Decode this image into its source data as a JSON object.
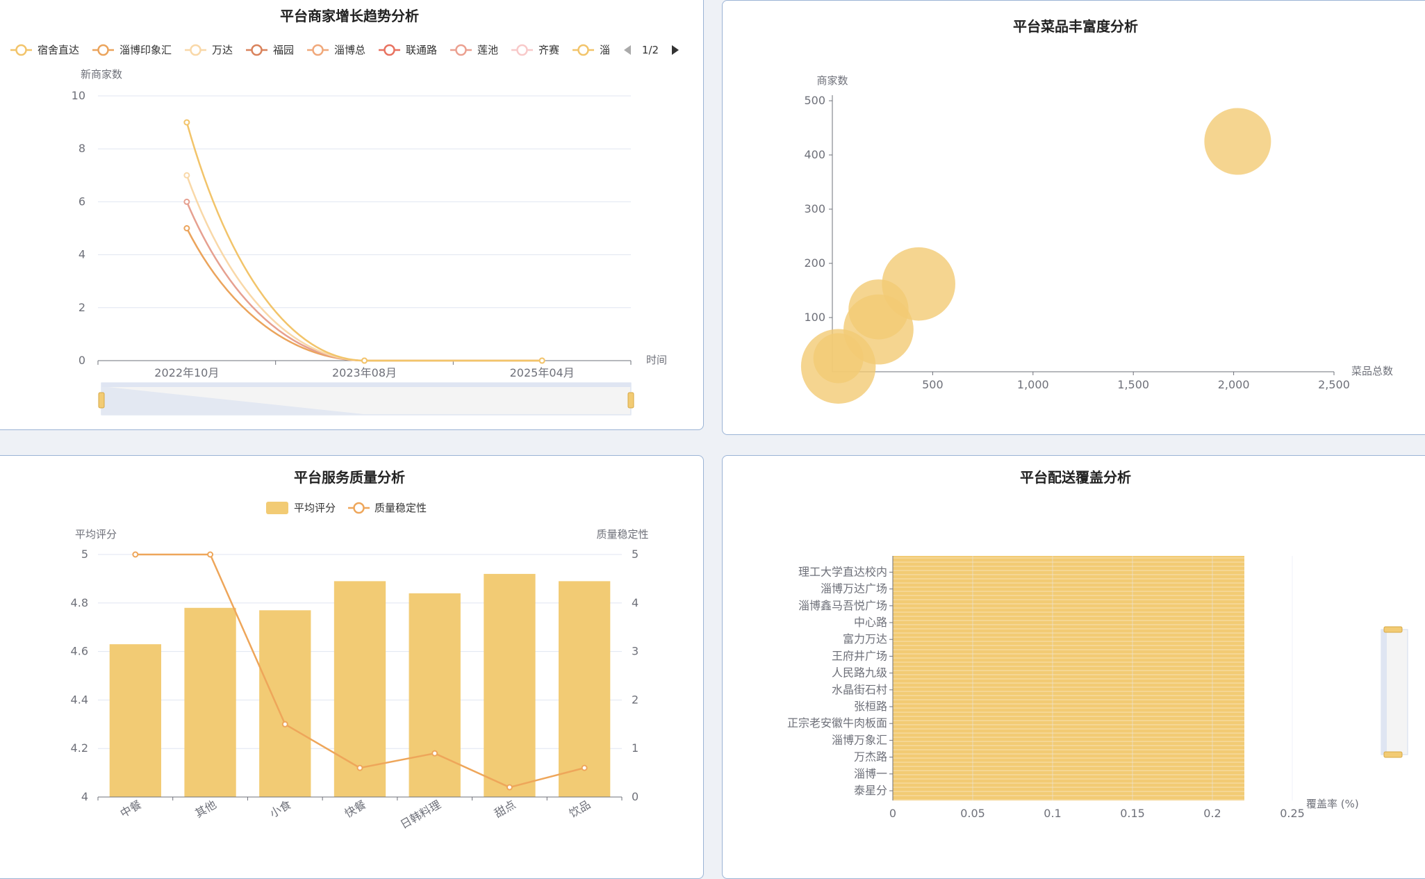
{
  "colors": {
    "bar": "#f2cb74",
    "line_stability": "#eea65a",
    "axis": "#6e7079",
    "grid": "#e0e6f1"
  },
  "chart_data": [
    {
      "id": "merchant-growth",
      "type": "line",
      "title": "平台商家增长趋势分析",
      "xlabel": "时间",
      "ylabel": "新商家数",
      "ylim": [
        0,
        10
      ],
      "yticks": [
        "0",
        "2",
        "4",
        "6",
        "8",
        "10"
      ],
      "categories": [
        "2022年10月",
        "2023年08月",
        "2025年04月"
      ],
      "legend": {
        "position": "top",
        "page": "1/2",
        "items": [
          "宿舍直达",
          "淄博印象汇",
          "万达",
          "福园",
          "淄博总",
          "联通路",
          "莲池",
          "齐赛",
          "淄"
        ]
      },
      "series": [
        {
          "name": "宿舍直达",
          "color": "#f2c46a",
          "values": [
            9,
            0,
            0
          ]
        },
        {
          "name": "万达",
          "color": "#f9d8a8",
          "values": [
            7,
            0,
            0
          ]
        },
        {
          "name": "莲池",
          "color": "#e6a090",
          "values": [
            6,
            0,
            0
          ]
        },
        {
          "name": "淄博印象汇",
          "color": "#eba45c",
          "values": [
            5,
            0,
            0
          ]
        }
      ]
    },
    {
      "id": "dish-richness",
      "type": "scatter",
      "title": "平台菜品丰富度分析",
      "xlabel": "菜品总数",
      "ylabel": "商家数",
      "xlim": [
        0,
        2500
      ],
      "ylim": [
        0,
        500
      ],
      "xticks": [
        "500",
        "1,000",
        "1,500",
        "2,000",
        "2,500"
      ],
      "yticks": [
        "100",
        "200",
        "300",
        "400",
        "500"
      ],
      "points": [
        {
          "x": 2020,
          "y": 425,
          "size": 1.0
        },
        {
          "x": 430,
          "y": 162,
          "size": 1.1
        },
        {
          "x": 230,
          "y": 115,
          "size": 0.9
        },
        {
          "x": 230,
          "y": 78,
          "size": 1.05
        },
        {
          "x": 30,
          "y": 10,
          "size": 1.12
        },
        {
          "x": 30,
          "y": 25,
          "size": 0.75
        }
      ]
    },
    {
      "id": "service-quality",
      "type": "bar",
      "title": "平台服务质量分析",
      "ylabel": "平均评分",
      "y2label": "质量稳定性",
      "ylim": [
        4,
        5
      ],
      "y2lim": [
        0,
        5
      ],
      "yticks": [
        "4",
        "4.2",
        "4.4",
        "4.6",
        "4.8",
        "5"
      ],
      "y2ticks": [
        "0",
        "1",
        "2",
        "3",
        "4",
        "5"
      ],
      "categories": [
        "中餐",
        "其他",
        "小食",
        "快餐",
        "日韩料理",
        "甜点",
        "饮品"
      ],
      "legend": {
        "position": "top",
        "items": [
          "平均评分",
          "质量稳定性"
        ]
      },
      "series": [
        {
          "name": "平均评分",
          "type": "bar",
          "values": [
            4.63,
            4.78,
            4.77,
            4.89,
            4.84,
            4.92,
            4.89
          ]
        },
        {
          "name": "质量稳定性",
          "type": "line",
          "axis": "right",
          "values": [
            5,
            5,
            1.5,
            0.6,
            0.9,
            0.2,
            0.6
          ]
        }
      ]
    },
    {
      "id": "delivery-coverage",
      "type": "bar",
      "orientation": "horizontal",
      "title": "平台配送覆盖分析",
      "xlabel": "覆盖率 (%)",
      "xlim": [
        0,
        0.25
      ],
      "xticks": [
        "0",
        "0.05",
        "0.1",
        "0.15",
        "0.2",
        "0.25"
      ],
      "categories": [
        "泰星分",
        "淄博一",
        "万杰路",
        "淄博万象汇",
        "正宗老安徽牛肉板面",
        "张桓路",
        "水晶街石村",
        "人民路九级",
        "王府井广场",
        "富力万达",
        "中心路",
        "淄博鑫马吾悦广场",
        "淄博万达广场",
        "理工大学直达校内"
      ],
      "values_all_approx": 0.22
    }
  ]
}
